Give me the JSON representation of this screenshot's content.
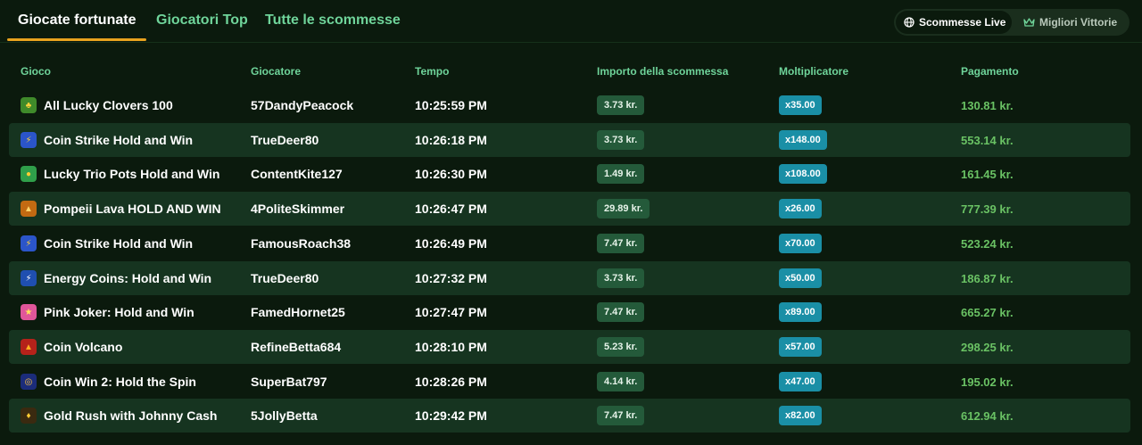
{
  "tabs": [
    {
      "label": "Giocate fortunate",
      "active": true
    },
    {
      "label": "Giocatori Top",
      "active": false
    },
    {
      "label": "Tutte le scommesse",
      "active": false
    }
  ],
  "toggle": {
    "live_label": "Scommesse Live",
    "best_label": "Migliori Vittorie"
  },
  "columns": {
    "game": "Gioco",
    "player": "Giocatore",
    "time": "Tempo",
    "bet": "Importo della scommessa",
    "multiplier": "Moltiplicatore",
    "payout": "Pagamento"
  },
  "rows": [
    {
      "game": "All Lucky Clovers 100",
      "icon": "clover-icon",
      "player": "57DandyPeacock",
      "time": "10:25:59 PM",
      "bet": "3.73 kr.",
      "multiplier": "x35.00",
      "payout": "130.81 kr."
    },
    {
      "game": "Coin Strike Hold and Win",
      "icon": "coin-strike-icon",
      "player": "TrueDeer80",
      "time": "10:26:18 PM",
      "bet": "3.73 kr.",
      "multiplier": "x148.00",
      "payout": "553.14 kr."
    },
    {
      "game": "Lucky Trio Pots Hold and Win",
      "icon": "pots-icon",
      "player": "ContentKite127",
      "time": "10:26:30 PM",
      "bet": "1.49 kr.",
      "multiplier": "x108.00",
      "payout": "161.45 kr."
    },
    {
      "game": "Pompeii Lava HOLD AND WIN",
      "icon": "volcano-lava-icon",
      "player": "4PoliteSkimmer",
      "time": "10:26:47 PM",
      "bet": "29.89 kr.",
      "multiplier": "x26.00",
      "payout": "777.39 kr."
    },
    {
      "game": "Coin Strike Hold and Win",
      "icon": "coin-strike-icon",
      "player": "FamousRoach38",
      "time": "10:26:49 PM",
      "bet": "7.47 kr.",
      "multiplier": "x70.00",
      "payout": "523.24 kr."
    },
    {
      "game": "Energy Coins: Hold and Win",
      "icon": "energy-coin-icon",
      "player": "TrueDeer80",
      "time": "10:27:32 PM",
      "bet": "3.73 kr.",
      "multiplier": "x50.00",
      "payout": "186.87 kr."
    },
    {
      "game": "Pink Joker: Hold and Win",
      "icon": "pink-joker-icon",
      "player": "FamedHornet25",
      "time": "10:27:47 PM",
      "bet": "7.47 kr.",
      "multiplier": "x89.00",
      "payout": "665.27 kr."
    },
    {
      "game": "Coin Volcano",
      "icon": "volcano-icon",
      "player": "RefineBetta684",
      "time": "10:28:10 PM",
      "bet": "5.23 kr.",
      "multiplier": "x57.00",
      "payout": "298.25 kr."
    },
    {
      "game": "Coin Win 2: Hold the Spin",
      "icon": "coin-win-icon",
      "player": "SuperBat797",
      "time": "10:28:26 PM",
      "bet": "4.14 kr.",
      "multiplier": "x47.00",
      "payout": "195.02 kr."
    },
    {
      "game": "Gold Rush with Johnny Cash",
      "icon": "gold-rush-icon",
      "player": "5JollyBetta",
      "time": "10:29:42 PM",
      "bet": "7.47 kr.",
      "multiplier": "x82.00",
      "payout": "612.94 kr."
    }
  ],
  "colors": {
    "background": "#0b1a0d",
    "row_alt": "#163420",
    "accent_green": "#6fd49a",
    "underline": "#e8a21e",
    "bet_badge": "#245a3a",
    "multiplier_badge": "#1a8fa6",
    "payout": "#6ac264"
  }
}
